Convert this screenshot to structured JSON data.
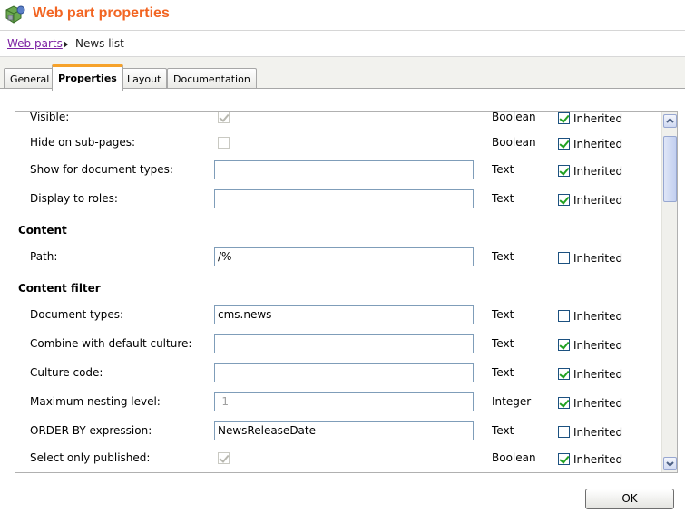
{
  "header": {
    "title": "Web part properties",
    "logo_icon": "webpart-puzzle-icon"
  },
  "breadcrumb": {
    "link": "Web parts",
    "current": "News list"
  },
  "tabs": [
    {
      "label": "General",
      "active": false
    },
    {
      "label": "Properties",
      "active": true
    },
    {
      "label": "Layout",
      "active": false
    },
    {
      "label": "Documentation",
      "active": false
    }
  ],
  "inherited_label": "Inherited",
  "rows": [
    {
      "kind": "checkbox",
      "label": "Visible:",
      "checked": true,
      "type": "Boolean",
      "inherited": true
    },
    {
      "kind": "checkbox",
      "label": "Hide on sub-pages:",
      "checked": false,
      "type": "Boolean",
      "inherited": true
    },
    {
      "kind": "text",
      "label": "Show for document types:",
      "value": "",
      "type": "Text",
      "inherited": true
    },
    {
      "kind": "text",
      "label": "Display to roles:",
      "value": "",
      "type": "Text",
      "inherited": true
    },
    {
      "kind": "section",
      "label": "Content"
    },
    {
      "kind": "text",
      "label": "Path:",
      "value": "/%",
      "type": "Text",
      "inherited": false
    },
    {
      "kind": "section",
      "label": "Content filter"
    },
    {
      "kind": "text",
      "label": "Document types:",
      "value": "cms.news",
      "type": "Text",
      "inherited": false
    },
    {
      "kind": "text",
      "label": "Combine with default culture:",
      "value": "",
      "type": "Text",
      "inherited": true
    },
    {
      "kind": "text",
      "label": "Culture code:",
      "value": "",
      "type": "Text",
      "inherited": true
    },
    {
      "kind": "text",
      "label": "Maximum nesting level:",
      "value": "-1",
      "type": "Integer",
      "inherited": true,
      "disabled": true
    },
    {
      "kind": "text",
      "label": "ORDER BY expression:",
      "value": "NewsReleaseDate",
      "type": "Text",
      "inherited": false
    },
    {
      "kind": "checkbox",
      "label": "Select only published:",
      "checked": true,
      "type": "Boolean",
      "inherited": true
    }
  ],
  "footer": {
    "ok_label": "OK"
  }
}
